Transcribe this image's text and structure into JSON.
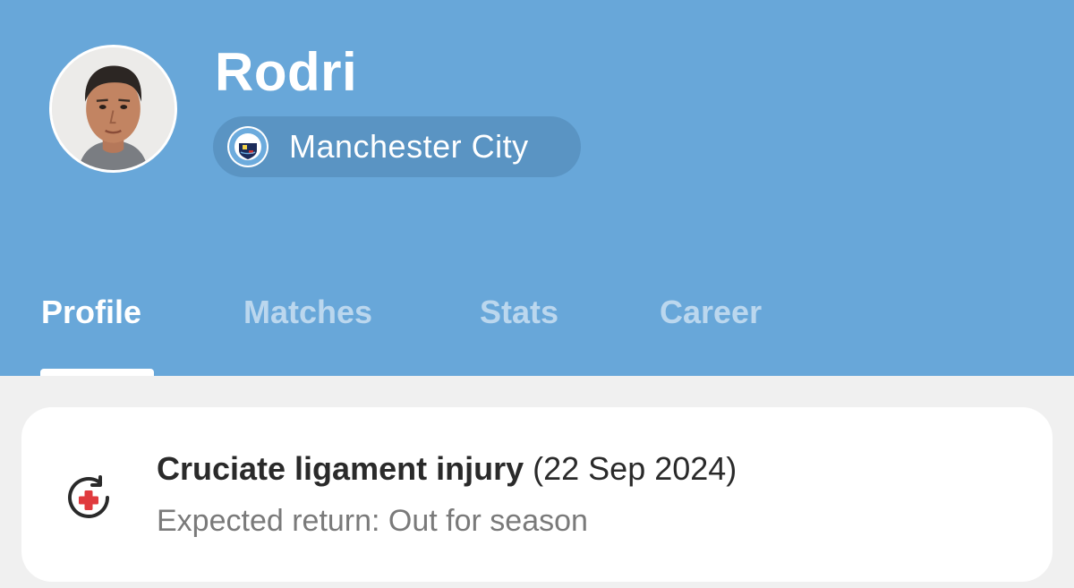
{
  "player": {
    "name": "Rodri",
    "team": "Manchester City",
    "avatar_icon": "player-photo",
    "crest_icon": "manchester-city-crest"
  },
  "tabs": [
    {
      "label": "Profile",
      "active": true
    },
    {
      "label": "Matches",
      "active": false
    },
    {
      "label": "Stats",
      "active": false
    },
    {
      "label": "Career",
      "active": false
    }
  ],
  "injury": {
    "icon": "injury-recovery-icon",
    "title": "Cruciate ligament injury",
    "date": "(22 Sep 2024)",
    "expected_return": "Expected return: Out for season"
  },
  "colors": {
    "header_bg": "#68a7d9",
    "page_bg": "#f0f0f0",
    "card_bg": "#ffffff",
    "injury_red": "#e03a3e"
  }
}
